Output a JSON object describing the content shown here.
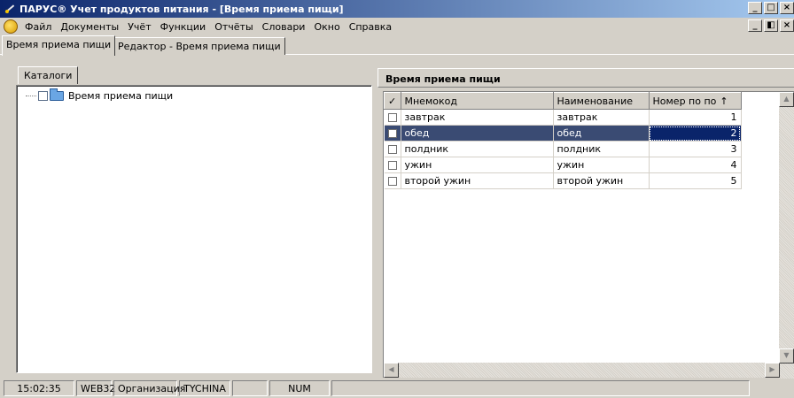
{
  "window": {
    "title": "ПАРУС® Учет продуктов питания - [Время приема пищи]",
    "min_symbol": "_",
    "max_symbol": "□",
    "close_symbol": "×",
    "restore_symbol": "◧"
  },
  "menu": {
    "items": [
      "Файл",
      "Документы",
      "Учёт",
      "Функции",
      "Отчёты",
      "Словари",
      "Окно",
      "Справка"
    ]
  },
  "tabs": [
    {
      "label": "Время приема пищи",
      "active": true
    },
    {
      "label": "Редактор - Время приема пищи",
      "active": false
    }
  ],
  "catalog": {
    "tab_label": "Каталоги",
    "tree": [
      {
        "label": "Время приема пищи",
        "checked": false
      }
    ]
  },
  "grid": {
    "title": "Время приема пищи",
    "check_header": "✓",
    "columns": [
      "Мнемокод",
      "Наименование",
      "Номер по по"
    ],
    "sort_indicator": "↑",
    "rows": [
      {
        "mnemo": "завтрак",
        "name": "завтрак",
        "num": "1",
        "selected": false
      },
      {
        "mnemo": "обед",
        "name": "обед",
        "num": "2",
        "selected": true
      },
      {
        "mnemo": "полдник",
        "name": "полдник",
        "num": "3",
        "selected": false
      },
      {
        "mnemo": "ужин",
        "name": "ужин",
        "num": "4",
        "selected": false
      },
      {
        "mnemo": "второй ужин",
        "name": "второй ужин",
        "num": "5",
        "selected": false
      }
    ]
  },
  "status": {
    "time": "15:02:35",
    "db": "WEB32",
    "org": "Организация",
    "user": "TYCHINA",
    "empty": "",
    "num": "NUM"
  },
  "colors": {
    "selection": "#3a4b73",
    "focus": "#0a246a",
    "title_gradient_start": "#0a246a",
    "face": "#d4d0c8"
  }
}
